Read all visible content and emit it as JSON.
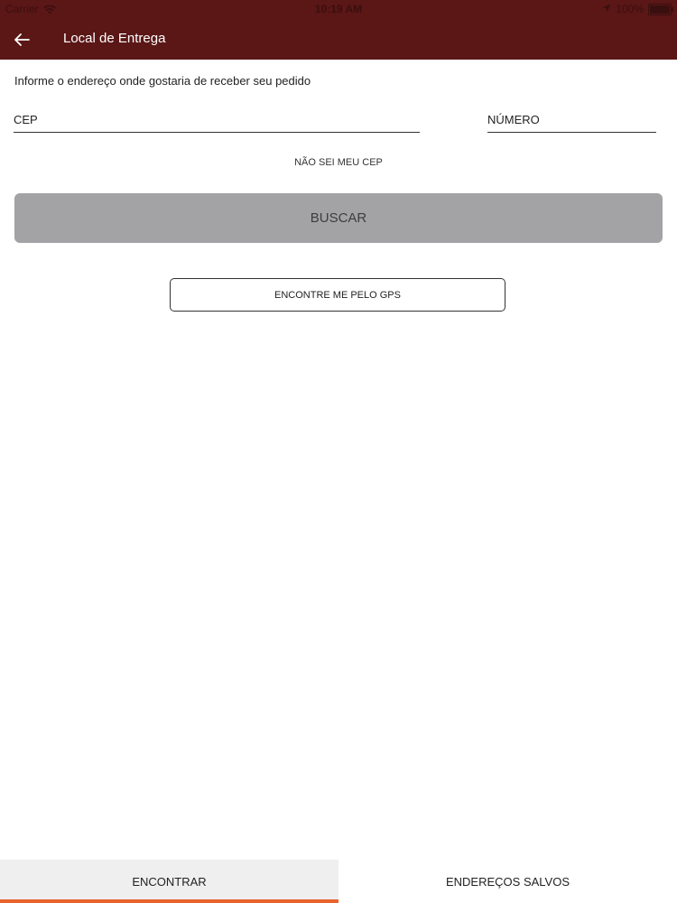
{
  "status_bar": {
    "carrier": "Carrier",
    "time": "10:19 AM",
    "battery": "100%",
    "battery_level": 1.0,
    "icons": [
      "wifi-icon",
      "location-arrow-icon",
      "battery-icon"
    ]
  },
  "header": {
    "title": "Local de Entrega",
    "back_icon": "arrow-left-icon",
    "background": "#5b1616"
  },
  "form": {
    "instruction": "Informe o endereço onde gostaria de receber seu pedido",
    "cep_placeholder": "CEP",
    "cep_value": "",
    "numero_placeholder": "NÚMERO",
    "numero_value": "",
    "unknown_cep_link": "NÃO SEI MEU CEP",
    "search_button": "BUSCAR",
    "gps_button": "ENCONTRE ME PELO GPS"
  },
  "tabs": [
    {
      "label": "ENCONTRAR",
      "active": true
    },
    {
      "label": "ENDEREÇOS SALVOS",
      "active": false
    }
  ],
  "colors": {
    "accent": "#e8642c",
    "header": "#5b1616",
    "disabled_button": "#a3a3a6"
  }
}
